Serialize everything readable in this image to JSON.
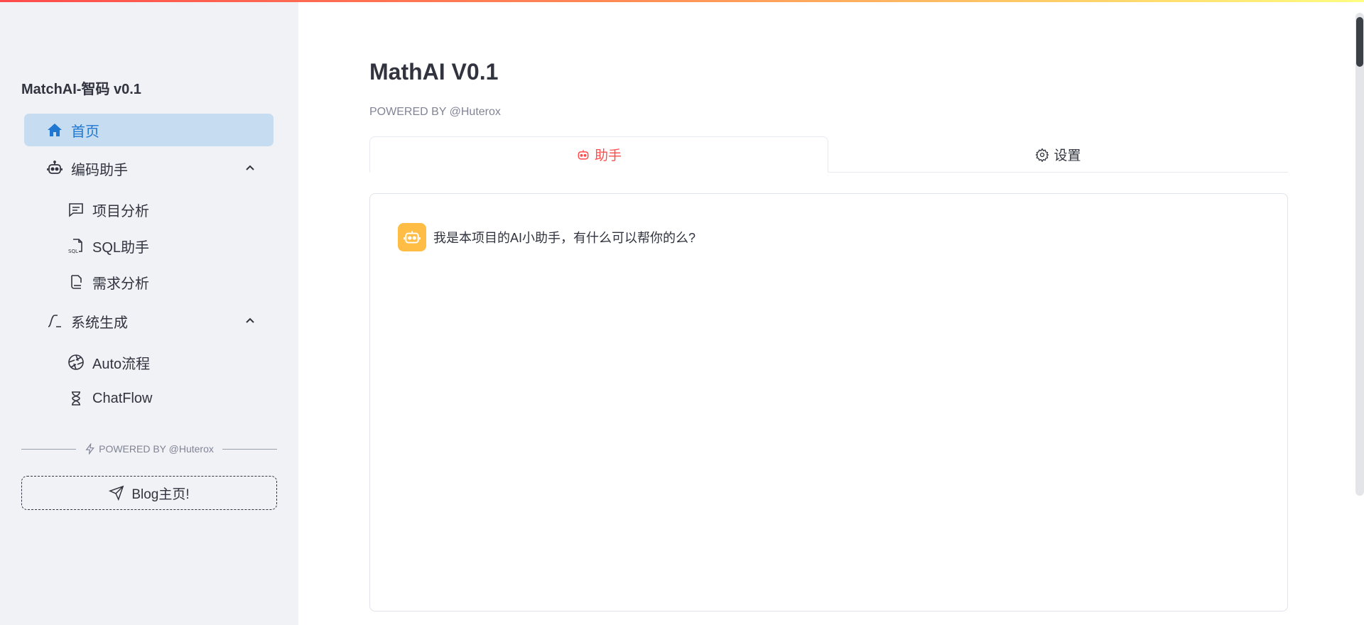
{
  "colors": {
    "accent": "#ff4b4b",
    "nav_active_bg": "#c6dcf1",
    "nav_active_text": "#1f77d2",
    "avatar_bg": "#ffbd45"
  },
  "sidebar": {
    "brand": "MatchAI-智码 v0.1",
    "home": {
      "label": "首页",
      "icon": "home-icon"
    },
    "groups": [
      {
        "label": "编码助手",
        "icon": "robot-icon",
        "items": [
          {
            "label": "项目分析",
            "icon": "message-square-icon"
          },
          {
            "label": "SQL助手",
            "icon": "sql-file-icon"
          },
          {
            "label": "需求分析",
            "icon": "document-icon"
          }
        ]
      },
      {
        "label": "系统生成",
        "icon": "function-icon",
        "items": [
          {
            "label": "Auto流程",
            "icon": "aperture-icon"
          },
          {
            "label": "ChatFlow",
            "icon": "hourglass-icon"
          }
        ]
      }
    ],
    "footer_caption": "POWERED BY @Huterox",
    "blog_button": "Blog主页!"
  },
  "main": {
    "title": "MathAI V0.1",
    "caption": "POWERED BY @Huterox",
    "tabs": [
      {
        "label": "助手",
        "icon": "robot-icon",
        "active": true
      },
      {
        "label": "设置",
        "icon": "gear-icon",
        "active": false
      }
    ],
    "messages": [
      {
        "role": "assistant",
        "text": "我是本项目的AI小助手，有什么可以帮你的么?"
      }
    ]
  }
}
